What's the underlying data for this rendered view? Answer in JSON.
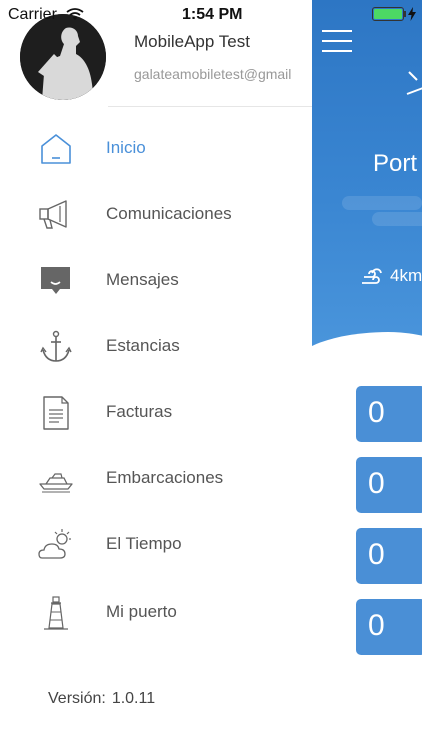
{
  "status_bar": {
    "carrier": "Carrier",
    "time": "1:54 PM",
    "battery_color": "#4cd964"
  },
  "drawer": {
    "user": {
      "name": "MobileApp Test",
      "email": "galateamobiletest@gmail"
    },
    "menu": [
      {
        "label": "Inicio",
        "icon": "home-icon",
        "active": true
      },
      {
        "label": "Comunicaciones",
        "icon": "megaphone-icon",
        "active": false
      },
      {
        "label": "Mensajes",
        "icon": "chat-bubble-icon",
        "active": false
      },
      {
        "label": "Estancias",
        "icon": "anchor-icon",
        "active": false
      },
      {
        "label": "Facturas",
        "icon": "document-icon",
        "active": false
      },
      {
        "label": "Embarcaciones",
        "icon": "boat-icon",
        "active": false
      },
      {
        "label": "El Tiempo",
        "icon": "weather-icon",
        "active": false
      },
      {
        "label": "Mi puerto",
        "icon": "lighthouse-icon",
        "active": false
      }
    ],
    "version_label": "Versión:",
    "version_number": "1.0.11"
  },
  "main": {
    "city": "Port",
    "wind": "4km",
    "stats": [
      "0",
      "0",
      "0",
      "0"
    ]
  },
  "colors": {
    "accent": "#4a90d9",
    "hero_blue": "#3a86d2",
    "stat_blue": "#4a8fd6"
  }
}
